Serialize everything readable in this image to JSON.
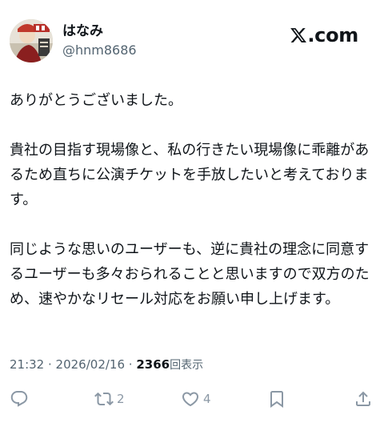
{
  "user": {
    "display_name": "はなみ",
    "handle": "@hnm8686",
    "avatar_icon": "user-avatar-icon"
  },
  "brand": {
    "text": ".com",
    "logo_icon": "x-logo-icon"
  },
  "post": {
    "paragraphs": [
      "ありがとうございました。",
      "貴社の目指す現場像と、私の行きたい現場像に乖離があるため直ちに公演チケットを手放したいと考えております。",
      "同じような思いのユーザーも、逆に貴社の理念に同意するユーザーも多々おられることと思いますので双方のため、速やかなリセール対応をお願い申し上げます。"
    ]
  },
  "meta": {
    "time": "21:32",
    "separator": " · ",
    "date": "2026/02/16",
    "views_count": "2366",
    "views_label": "回表示"
  },
  "actions": {
    "reply": {
      "icon": "reply-icon",
      "count": ""
    },
    "repost": {
      "icon": "repost-icon",
      "count": "2"
    },
    "like": {
      "icon": "heart-icon",
      "count": "4"
    },
    "bookmark": {
      "icon": "bookmark-icon",
      "count": ""
    },
    "share": {
      "icon": "share-icon",
      "count": ""
    }
  },
  "colors": {
    "text": "#0f1419",
    "secondary": "#536471",
    "action_gray": "#8b98a5"
  }
}
